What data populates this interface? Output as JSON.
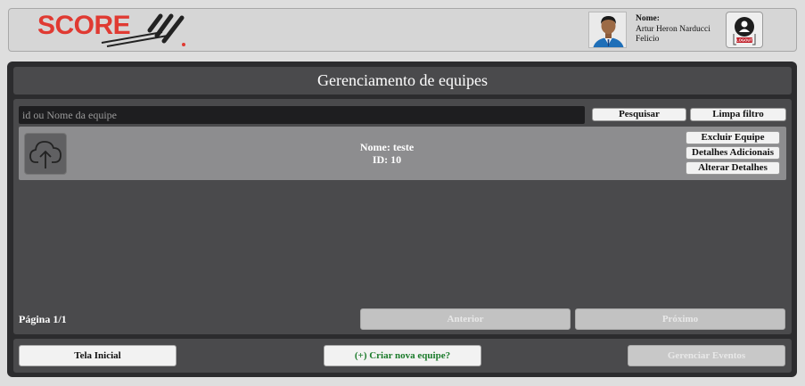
{
  "brand": {
    "name": "SCORE",
    "color": "#e03a32"
  },
  "user": {
    "label": "Nome:",
    "name": "Artur Heron Narducci Felicio"
  },
  "logout": {
    "icon": "logout-icon",
    "text": "LOGOUT"
  },
  "page": {
    "title": "Gerenciamento de equipes"
  },
  "search": {
    "placeholder": "id ou Nome da equipe",
    "value": "",
    "search_label": "Pesquisar",
    "clear_label": "Limpa filtro"
  },
  "teams": [
    {
      "name_text": "Nome: teste",
      "id_text": "ID: 10",
      "icon": "cloud-upload-icon",
      "actions": [
        "Excluir Equipe",
        "Detalhes Adicionais",
        "Alterar Detalhes"
      ]
    }
  ],
  "pagination": {
    "label": "Página 1/1",
    "prev_label": "Anterior",
    "next_label": "Próximo"
  },
  "footer": {
    "home_label": "Tela Inicial",
    "create_label": "(+) Criar nova equipe?",
    "events_label": "Gerenciar Eventos",
    "create_color": "#1a7a2a"
  }
}
